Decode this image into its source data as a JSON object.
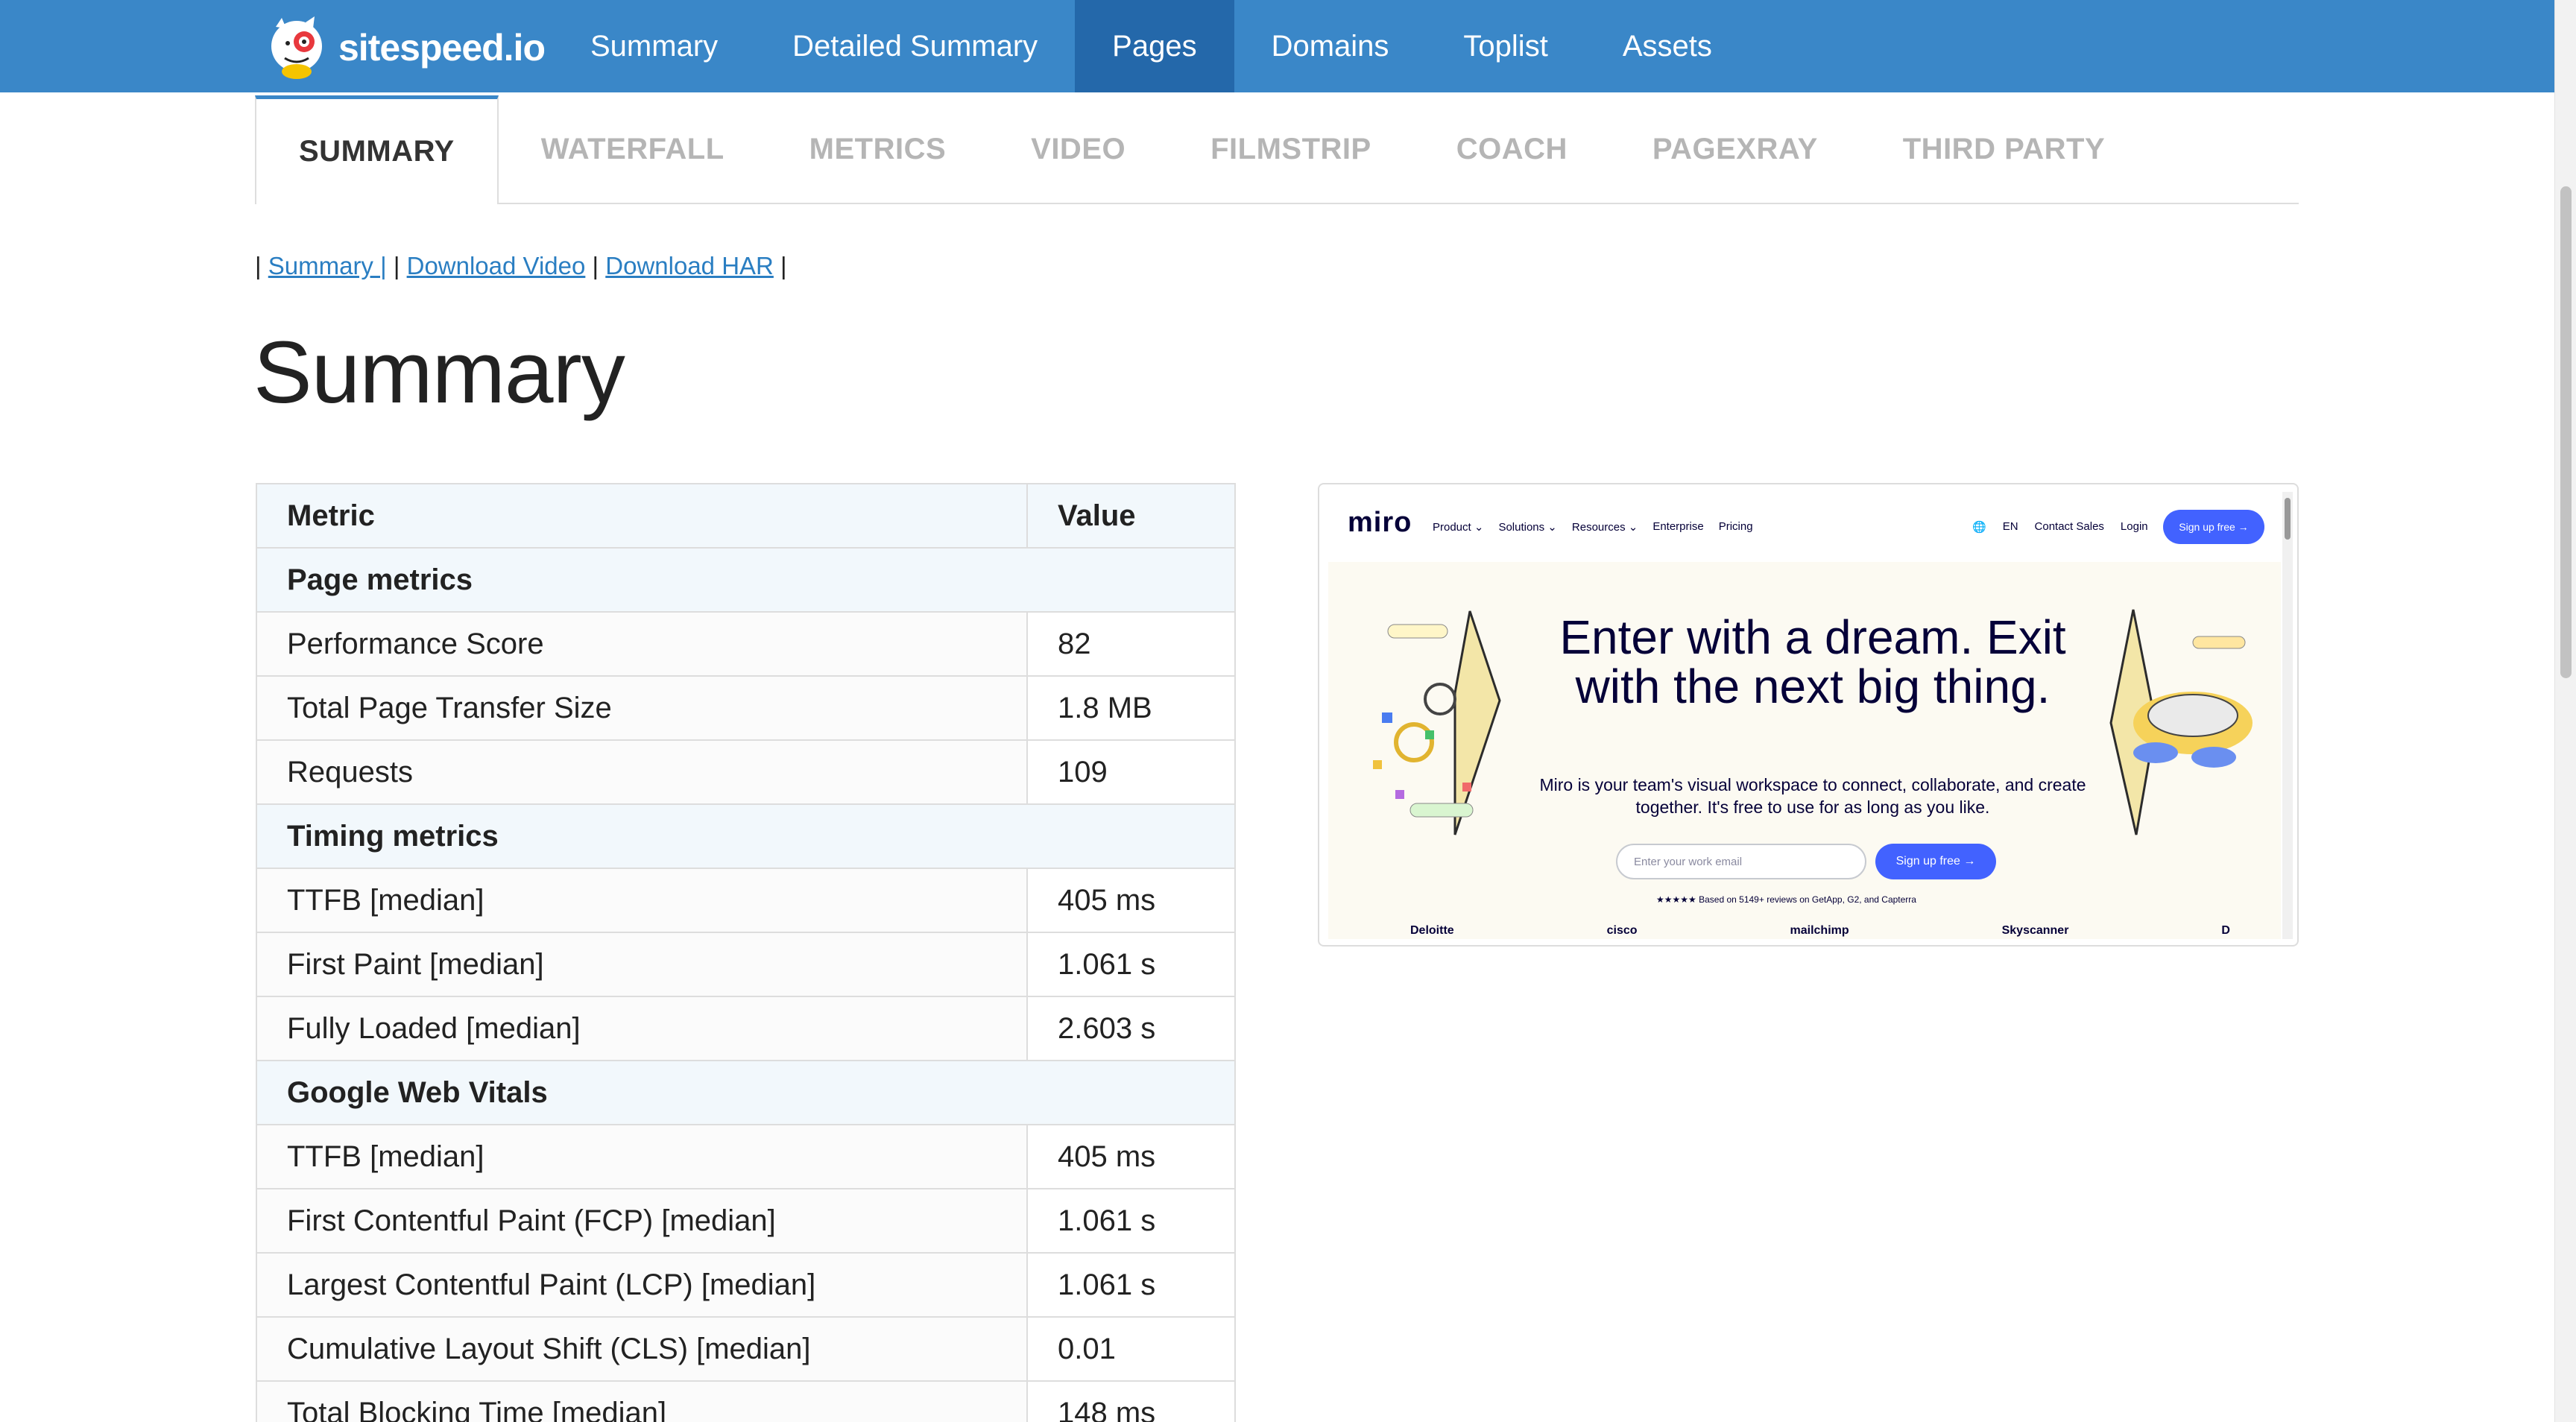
{
  "brand": {
    "name": "sitespeed.io"
  },
  "nav": {
    "items": [
      "Summary",
      "Detailed Summary",
      "Pages",
      "Domains",
      "Toplist",
      "Assets"
    ],
    "active_index": 2
  },
  "subtabs": {
    "items": [
      "SUMMARY",
      "WATERFALL",
      "METRICS",
      "VIDEO",
      "FILMSTRIP",
      "COACH",
      "PAGEXRAY",
      "THIRD PARTY"
    ],
    "active_index": 0
  },
  "links": {
    "summary": "Summary |",
    "download_video": "Download Video",
    "download_har": "Download HAR"
  },
  "page_title": "Summary",
  "table": {
    "header": {
      "metric": "Metric",
      "value": "Value"
    },
    "sections": [
      {
        "title": "Page metrics",
        "rows": [
          {
            "metric": "Performance Score",
            "value": "82"
          },
          {
            "metric": "Total Page Transfer Size",
            "value": "1.8 MB"
          },
          {
            "metric": "Requests",
            "value": "109"
          }
        ]
      },
      {
        "title": "Timing metrics",
        "rows": [
          {
            "metric": "TTFB [median]",
            "value": "405 ms"
          },
          {
            "metric": "First Paint [median]",
            "value": "1.061 s"
          },
          {
            "metric": "Fully Loaded [median]",
            "value": "2.603 s"
          }
        ]
      },
      {
        "title": "Google Web Vitals",
        "rows": [
          {
            "metric": "TTFB [median]",
            "value": "405 ms"
          },
          {
            "metric": "First Contentful Paint (FCP) [median]",
            "value": "1.061 s"
          },
          {
            "metric": "Largest Contentful Paint (LCP) [median]",
            "value": "1.061 s"
          },
          {
            "metric": "Cumulative Layout Shift (CLS) [median]",
            "value": "0.01"
          },
          {
            "metric": "Total Blocking Time [median]",
            "value": "148 ms"
          }
        ]
      }
    ]
  },
  "screenshot": {
    "logo": "miro",
    "nav_links": [
      "Product ⌄",
      "Solutions ⌄",
      "Resources ⌄",
      "Enterprise",
      "Pricing"
    ],
    "nav_right": [
      "EN",
      "Contact Sales",
      "Login"
    ],
    "signup": "Sign up free →",
    "hero_title": "Enter with a dream. Exit with the next big thing.",
    "hero_sub": "Miro is your team's visual workspace to connect, collaborate, and create together. It's free to use for as long as you like.",
    "email_placeholder": "Enter your work email",
    "cta": "Sign up free →",
    "rating": "★★★★★ Based on 5149+ reviews on GetApp, G2, and Capterra",
    "logos": [
      "Deloitte",
      "cisco",
      "mailchimp",
      "Skyscanner",
      "D"
    ]
  },
  "colors": {
    "nav_bg": "#3a87c8",
    "nav_active": "#2468aa",
    "link": "#2a7ec2",
    "miro_accent": "#4262ff"
  }
}
